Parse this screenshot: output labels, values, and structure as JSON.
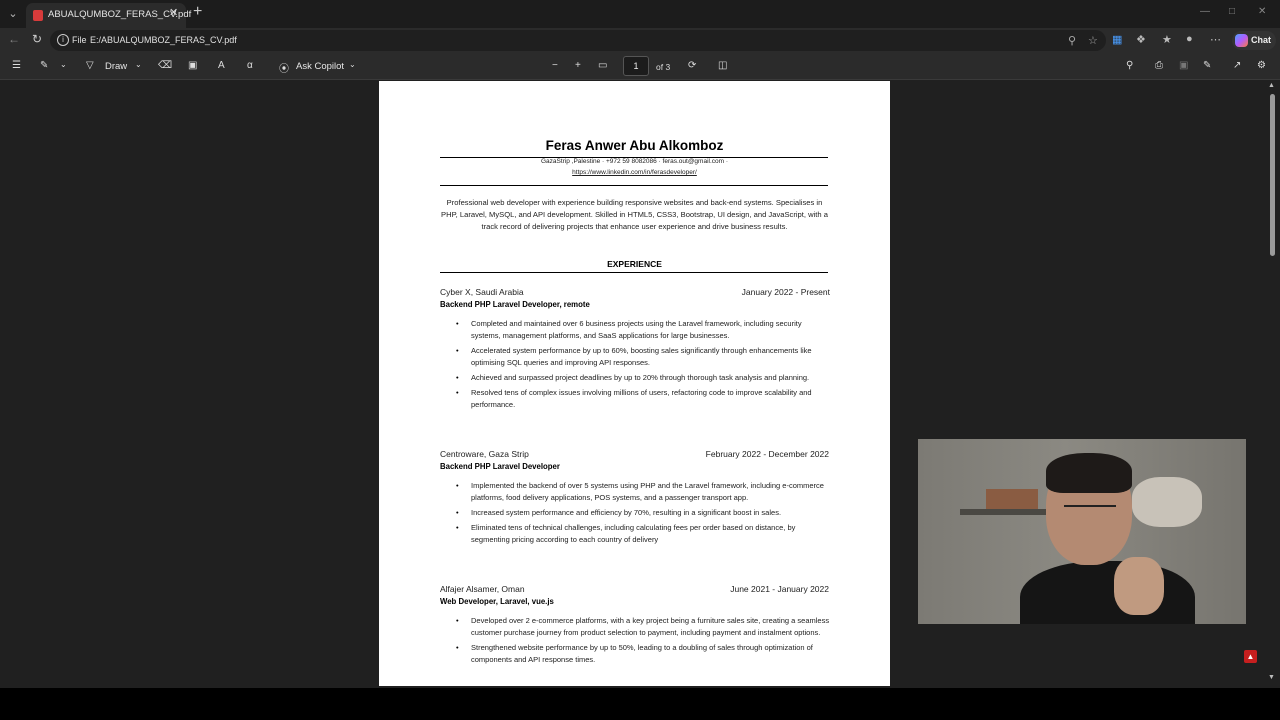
{
  "browser": {
    "tab_title": "ABUALQUMBOZ_FERAS_CV.pdf",
    "url_scheme": "File",
    "url": "E:/ABUALQUMBOZ_FERAS_CV.pdf",
    "copilot_label": "Chat"
  },
  "pdf_toolbar": {
    "draw_label": "Draw",
    "ask_copilot_label": "Ask Copilot",
    "current_page": "1",
    "page_count_label": "of 3"
  },
  "resume": {
    "name": "Feras Anwer Abu Alkomboz",
    "contact": "GazaStrip ,Palestine · +972 59 8082086 · feras.out@gmail.com ·",
    "linkedin": "https://www.linkedin.com/in/ferasdeveloper/",
    "summary": "Professional web developer with experience building responsive websites and back-end systems. Specialises in PHP, Laravel, MySQL, and API development. Skilled in HTML5, CSS3, Bootstrap, UI design, and JavaScript, with a track record of delivering projects that enhance user experience and drive business results.",
    "section_experience": "EXPERIENCE",
    "jobs": [
      {
        "company": "Cyber X, Saudi Arabia",
        "dates": "January 2022 - Present",
        "role": "Backend PHP Laravel Developer, remote",
        "bullets": [
          "Completed and maintained over 6 business projects using the Laravel framework, including security systems, management platforms, and SaaS applications for large businesses.",
          "Accelerated system performance by up to 60%, boosting sales significantly through enhancements like optimising SQL queries and improving API responses.",
          "Achieved and surpassed project deadlines by up to 20% through thorough task analysis and planning.",
          "Resolved tens of complex issues involving millions of users, refactoring code to improve scalability and performance."
        ]
      },
      {
        "company": "Centroware, Gaza Strip",
        "dates": "February 2022 - December 2022",
        "role": "Backend PHP Laravel Developer",
        "bullets": [
          "Implemented the backend of over 5 systems using PHP and the Laravel framework, including e-commerce platforms, food delivery applications, POS systems, and a passenger transport app.",
          "Increased system performance and efficiency by 70%, resulting in a significant boost in sales.",
          "Eliminated tens of technical challenges, including calculating fees per order based on distance, by segmenting pricing according to each country of delivery"
        ]
      },
      {
        "company": "Alfajer Alsamer, Oman",
        "dates": "June 2021 - January 2022",
        "role": "Web Developer, Laravel, vue.js",
        "bullets": [
          "Developed over 2 e-commerce platforms, with a key project being a furniture sales site, creating a seamless customer purchase journey from product selection to payment, including payment and instalment options.",
          "Strengthened website performance by up to 50%, leading to a doubling of sales through optimization of components and API response times."
        ]
      }
    ]
  }
}
